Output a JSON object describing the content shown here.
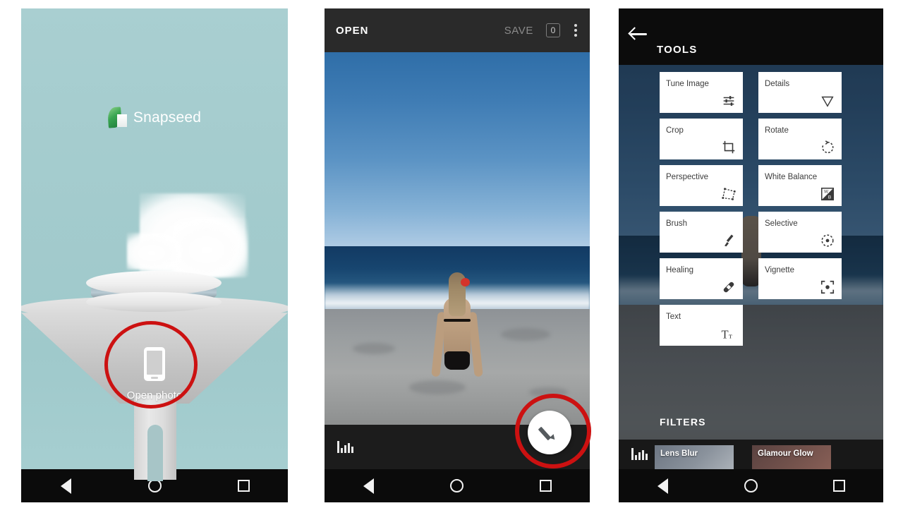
{
  "splash": {
    "brand_name": "Snapseed",
    "brand_icon": "snapseed-leaf-logo",
    "cta_label": "Open photo",
    "cta_icon": "phone-icon",
    "annotation_color": "#cc1111"
  },
  "editor": {
    "topbar": {
      "open_label": "OPEN",
      "save_label": "SAVE",
      "badge_count": "0",
      "menu_icon": "overflow-menu-icon"
    },
    "bottombar": {
      "histogram_icon": "histogram-icon",
      "edit_fab_icon": "pencil-icon"
    }
  },
  "tools": {
    "back_icon": "back-arrow-icon",
    "title": "TOOLS",
    "items": [
      {
        "label": "Tune Image",
        "icon": "sliders-icon"
      },
      {
        "label": "Details",
        "icon": "triangle-down-icon"
      },
      {
        "label": "Crop",
        "icon": "crop-icon"
      },
      {
        "label": "Rotate",
        "icon": "rotate-icon"
      },
      {
        "label": "Perspective",
        "icon": "perspective-icon"
      },
      {
        "label": "White Balance",
        "icon": "white-balance-icon"
      },
      {
        "label": "Brush",
        "icon": "brush-icon"
      },
      {
        "label": "Selective",
        "icon": "selective-icon"
      },
      {
        "label": "Healing",
        "icon": "healing-icon"
      },
      {
        "label": "Vignette",
        "icon": "vignette-icon"
      },
      {
        "label": "Text",
        "icon": "text-icon"
      }
    ],
    "filters_title": "FILTERS",
    "filters": [
      {
        "label": "Lens Blur"
      },
      {
        "label": "Glamour Glow"
      }
    ],
    "histogram_icon": "histogram-icon"
  },
  "navbar": {
    "back_icon": "nav-back-icon",
    "home_icon": "nav-home-icon",
    "recents_icon": "nav-recents-icon"
  }
}
